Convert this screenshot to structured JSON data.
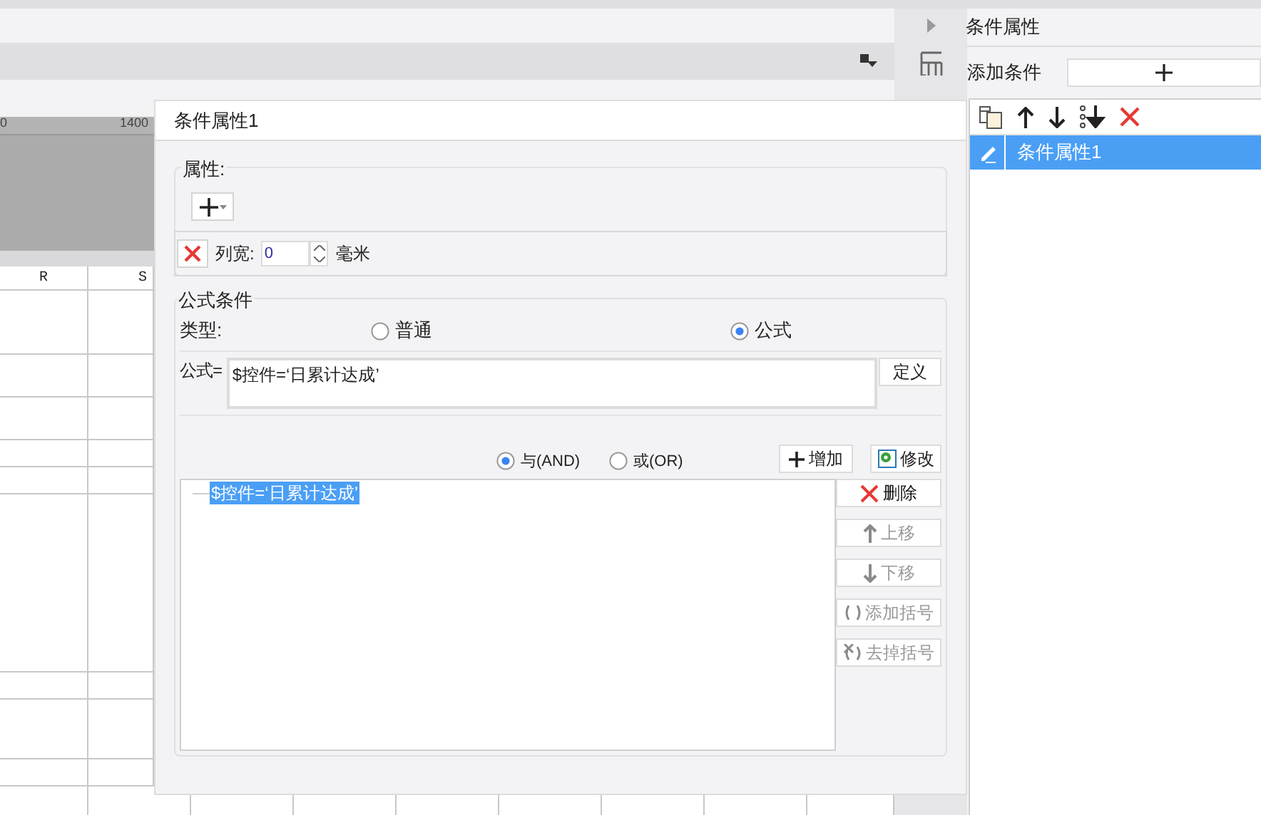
{
  "ruler": {
    "labels": [
      "0",
      "1400"
    ]
  },
  "sheet": {
    "columns": [
      "R",
      "S"
    ]
  },
  "dialog": {
    "title": "条件属性1",
    "attributes": {
      "label": "属性:",
      "rows": [
        {
          "label": "列宽:",
          "value": "0",
          "unit": "毫米"
        }
      ]
    },
    "formula_condition": {
      "label": "公式条件",
      "type_label": "类型:",
      "types": [
        {
          "label": "普通",
          "selected": false
        },
        {
          "label": "公式",
          "selected": true
        }
      ],
      "formula_label": "公式=",
      "formula": "$控件=‘日累计达成’",
      "define_button": "定义",
      "joins": [
        {
          "label": "与(AND)",
          "selected": true
        },
        {
          "label": "或(OR)",
          "selected": false
        }
      ],
      "add_button": "增加",
      "modify_button": "修改",
      "conditions": [
        {
          "text": "$控件=‘日累计达成’",
          "selected": true
        }
      ],
      "actions": [
        {
          "kind": "delete",
          "label": "删除",
          "disabled": false
        },
        {
          "kind": "up",
          "label": "上移",
          "disabled": true
        },
        {
          "kind": "down",
          "label": "下移",
          "disabled": true
        },
        {
          "kind": "add-paren",
          "label": "添加括号",
          "disabled": true
        },
        {
          "kind": "remove-paren",
          "label": "去掉括号",
          "disabled": true
        }
      ]
    }
  },
  "panel": {
    "title": "条件属性",
    "add_label": "添加条件",
    "items": [
      {
        "label": "条件属性1",
        "selected": true
      }
    ]
  }
}
